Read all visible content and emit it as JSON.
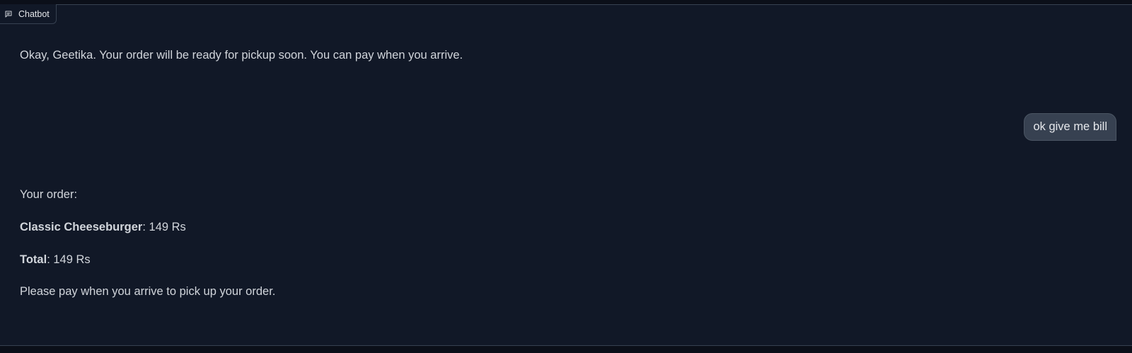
{
  "chatbot": {
    "label": "Chatbot",
    "icon": "chat-icon"
  },
  "messages": {
    "bot_1": "Okay, Geetika. Your order will be ready for pickup soon. You can pay when you arrive.",
    "user_1": "ok give me bill",
    "bot_2": {
      "heading": "Your order:",
      "item_name": "Classic Cheeseburger",
      "item_price": ": 149 Rs",
      "total_label": "Total",
      "total_value": ": 149 Rs",
      "note": "Please pay when you arrive to pick up your order."
    }
  },
  "colors": {
    "background": "#111827",
    "border": "#374151",
    "user_bubble": "#374151",
    "text": "#d1d5db"
  }
}
